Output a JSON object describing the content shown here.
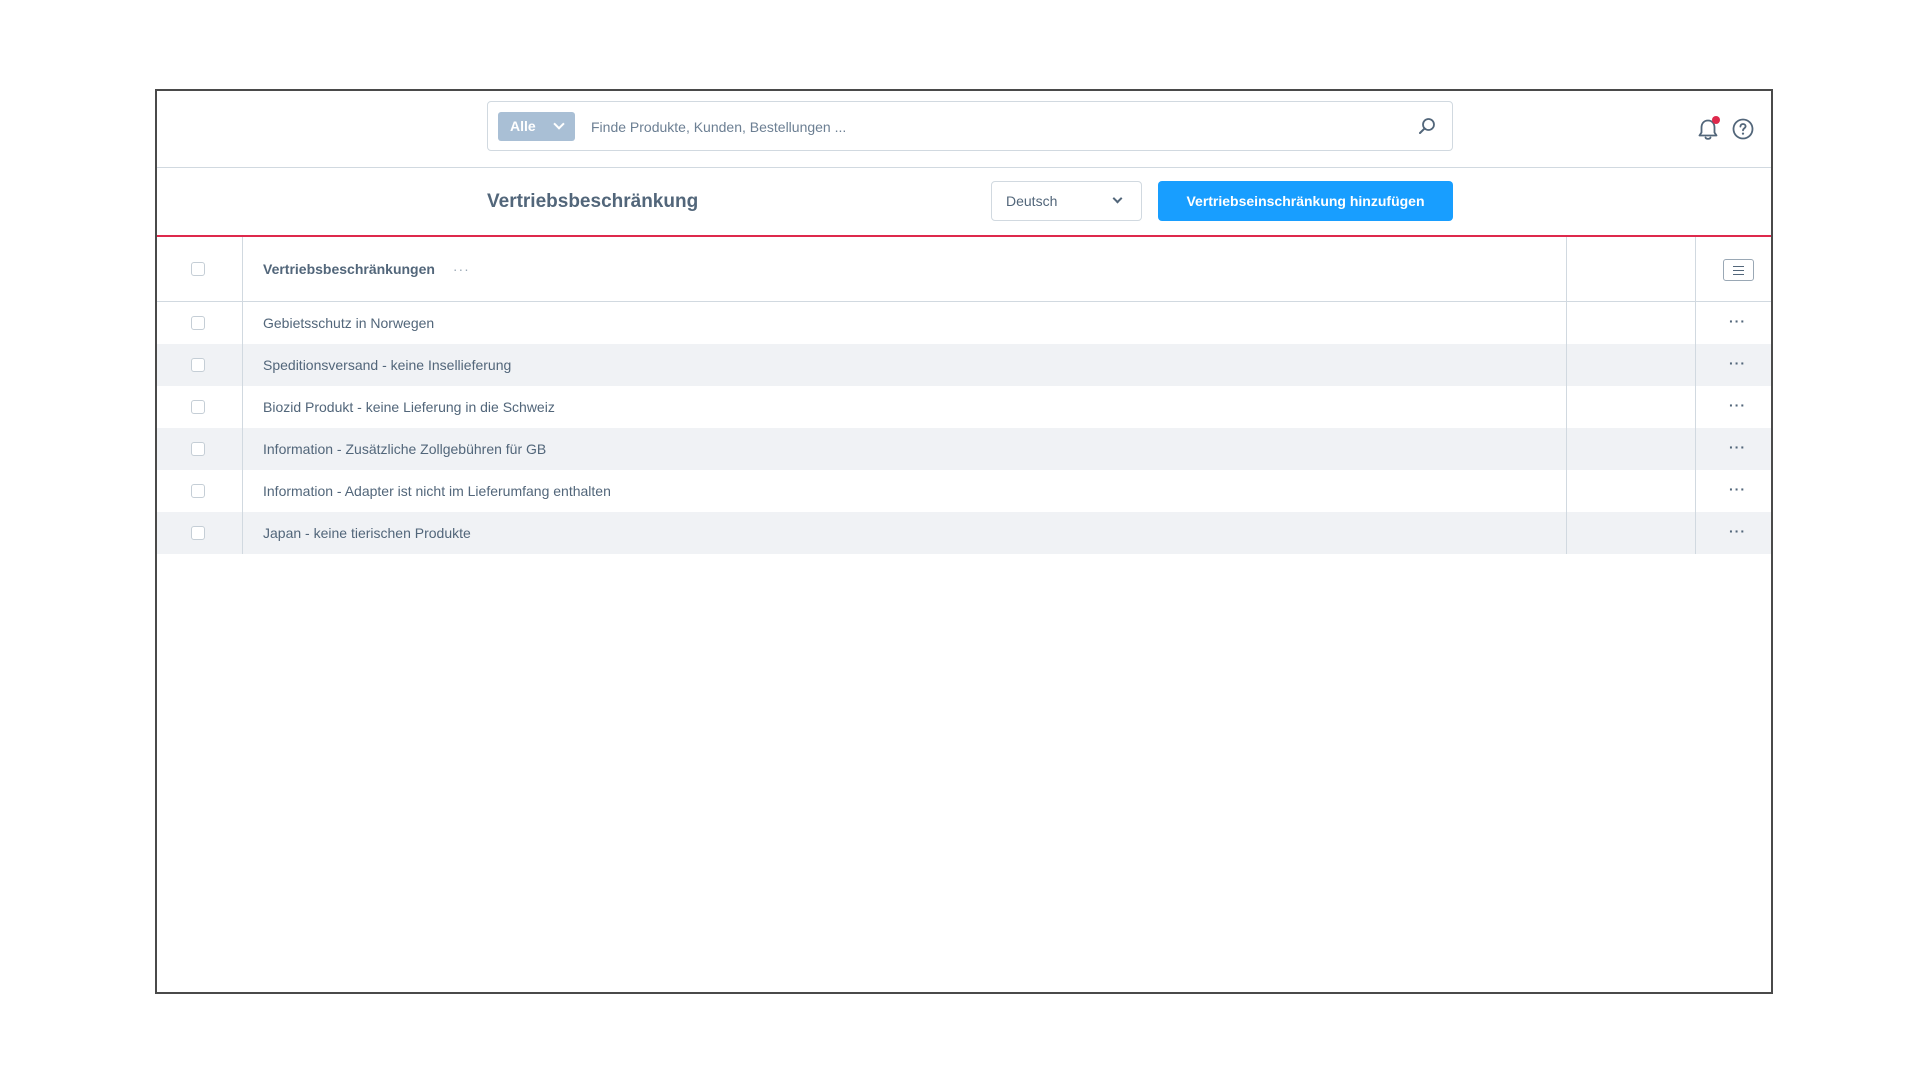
{
  "search": {
    "type_select": "Alle",
    "placeholder": "Finde Produkte, Kunden, Bestellungen ...",
    "value": ""
  },
  "header_icons": {
    "notification_icon": "bell-icon",
    "notification_badge_color": "#de294c",
    "help_icon": "help-circle-icon"
  },
  "page": {
    "title": "Vertriebsbeschränkung",
    "language_select": "Deutsch",
    "add_button_label": "Vertriebseinschränkung hinzufügen",
    "accent_color": "#189eff",
    "divider_color": "#de294c"
  },
  "grid": {
    "column_header": "Vertriebsbeschränkungen",
    "column_more": "···",
    "row_action": "···",
    "rows": [
      "Gebietsschutz in Norwegen",
      "Speditionsversand - keine Insellieferung",
      "Biozid Produkt - keine Lieferung in die Schweiz",
      "Information - Zusätzliche Zollgebühren für GB",
      "Information - Adapter ist nicht im Lieferumfang enthalten",
      "Japan - keine tierischen Produkte"
    ]
  }
}
